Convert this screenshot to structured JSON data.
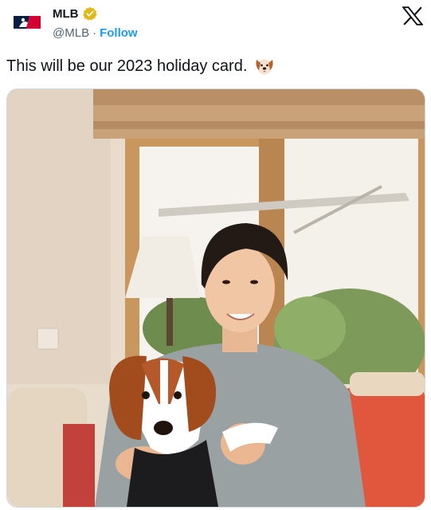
{
  "account": {
    "display_name": "MLB",
    "handle": "@MLB",
    "separator": "·",
    "follow_label": "Follow"
  },
  "tweet": {
    "text": "This will be our 2023 holiday card."
  },
  "icons": {
    "avatar": "mlb-logo-icon",
    "verified": "verified-badge-icon",
    "platform": "x-logo-icon",
    "emoji": "dog-face-emoji-icon"
  },
  "colors": {
    "link": "#1d9bf0",
    "verified_gold": "#e2b719",
    "text": "#0f1419",
    "muted": "#536471"
  }
}
